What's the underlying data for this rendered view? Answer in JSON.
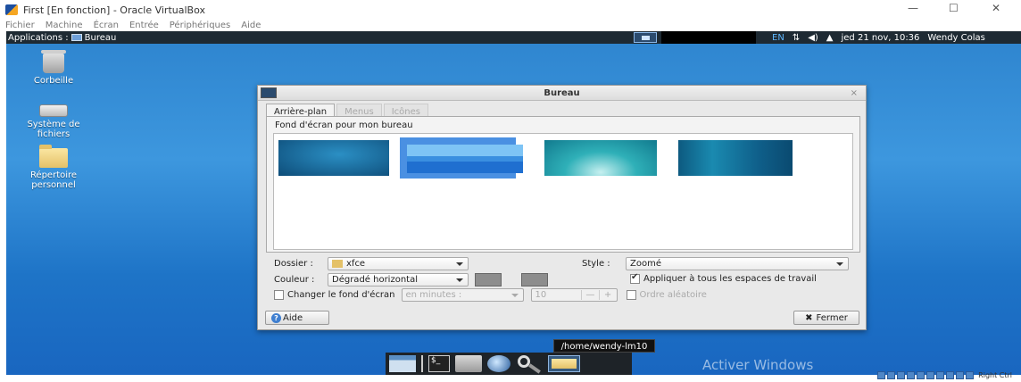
{
  "vbox": {
    "title": "First [En fonction] - Oracle VirtualBox",
    "menu": [
      "Fichier",
      "Machine",
      "Écran",
      "Entrée",
      "Périphériques",
      "Aide"
    ],
    "minimize": "—",
    "maximize": "☐",
    "close": "✕",
    "host_key": "Right Ctrl",
    "activate_text": "Activer Windows"
  },
  "panel": {
    "applications": "Applications :",
    "window_title": "Bureau",
    "lang": "EN",
    "clock": "jed 21 nov, 10:36",
    "user": "Wendy Colas"
  },
  "desktop_icons": [
    {
      "label": "Corbeille"
    },
    {
      "label": "Système de fichiers"
    },
    {
      "label": "Répertoire personnel"
    }
  ],
  "dialog": {
    "title": "Bureau",
    "close": "×",
    "tabs": [
      "Arrière-plan",
      "Menus",
      "Icônes"
    ],
    "section_label": "Fond d'écran pour mon bureau",
    "dossier_label": "Dossier :",
    "dossier_value": "xfce",
    "style_label": "Style :",
    "style_value": "Zoomé",
    "couleur_label": "Couleur :",
    "couleur_value": "Dégradé horizontal",
    "apply_all": "Appliquer à tous les espaces de travail",
    "change_label": "Changer le fond d'écran",
    "interval_value": "en minutes :",
    "interval_number": "10",
    "minus": "—",
    "plus": "+",
    "random_label": "Ordre aléatoire",
    "help": "Aide",
    "close_button": "Fermer",
    "close_glyph": "✖",
    "help_glyph": "?"
  },
  "tooltip": "/home/wendy-lm10",
  "colors": {
    "panel_bg": "#1e2a33",
    "selection": "#4a90e2",
    "desktop_top": "#2f86d0",
    "desktop_bottom": "#1966c0"
  }
}
